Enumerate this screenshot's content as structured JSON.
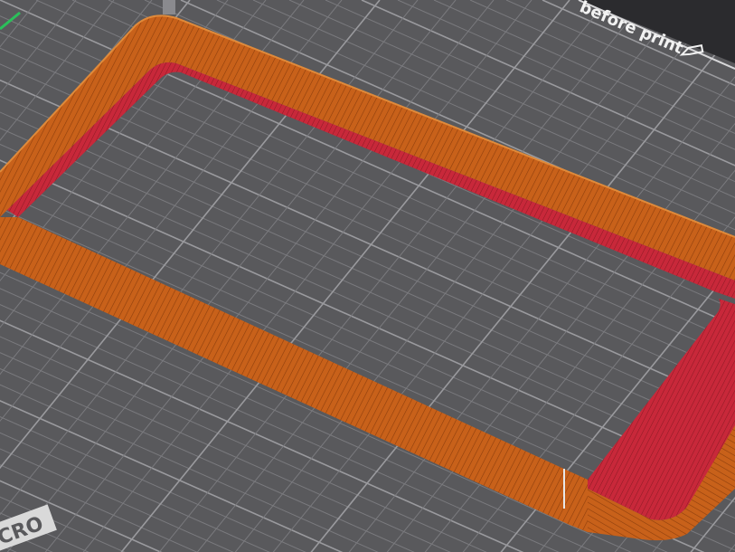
{
  "viewport": {
    "bed_label_text": "before print",
    "bed_label_icon": "pencil-icon",
    "bed_corner_text": "CRO",
    "colors": {
      "background": "#2b2b2e",
      "bed": "#59595c",
      "grid": "#7a7a7e",
      "grid_major": "#9a9a9e",
      "perimeter": "#c8611a",
      "perimeter_dark": "#8e3f0c",
      "infill": "#c8283a",
      "seam": "#e8e8e8",
      "axis_green": "#2bbf5a",
      "label": "#f2f2f2"
    }
  }
}
